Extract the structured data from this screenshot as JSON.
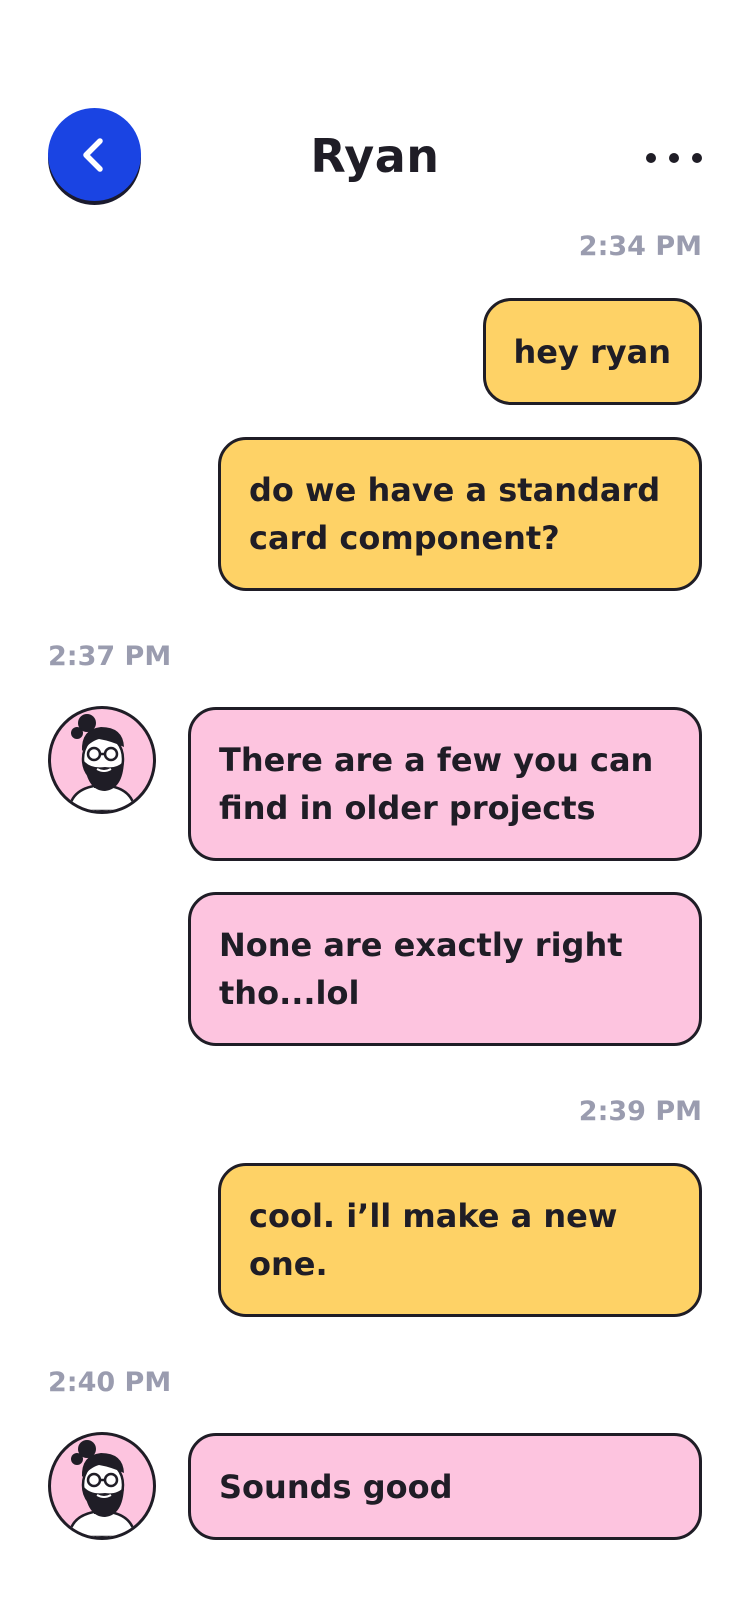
{
  "header": {
    "title": "Ryan",
    "back_icon": "chevron-left-icon",
    "more_icon": "more-horizontal-icon"
  },
  "colors": {
    "accent": "#1a44e3",
    "outgoing_bubble": "#fed266",
    "incoming_bubble": "#fdc4df",
    "timestamp": "#9a9caf",
    "text": "#1f1d26"
  },
  "messages": [
    {
      "sender": "me",
      "time": "2:34 PM",
      "text": "hey ryan"
    },
    {
      "sender": "me",
      "text": "do we have a standard card component?"
    },
    {
      "sender": "Ryan",
      "time": "2:37 PM",
      "text": "There are a few you can find in older projects"
    },
    {
      "sender": "Ryan",
      "text": "None are exactly right tho...lol"
    },
    {
      "sender": "me",
      "time": "2:39 PM",
      "text": "cool. i’ll make a new one."
    },
    {
      "sender": "Ryan",
      "time": "2:40 PM",
      "text": "Sounds good"
    }
  ]
}
